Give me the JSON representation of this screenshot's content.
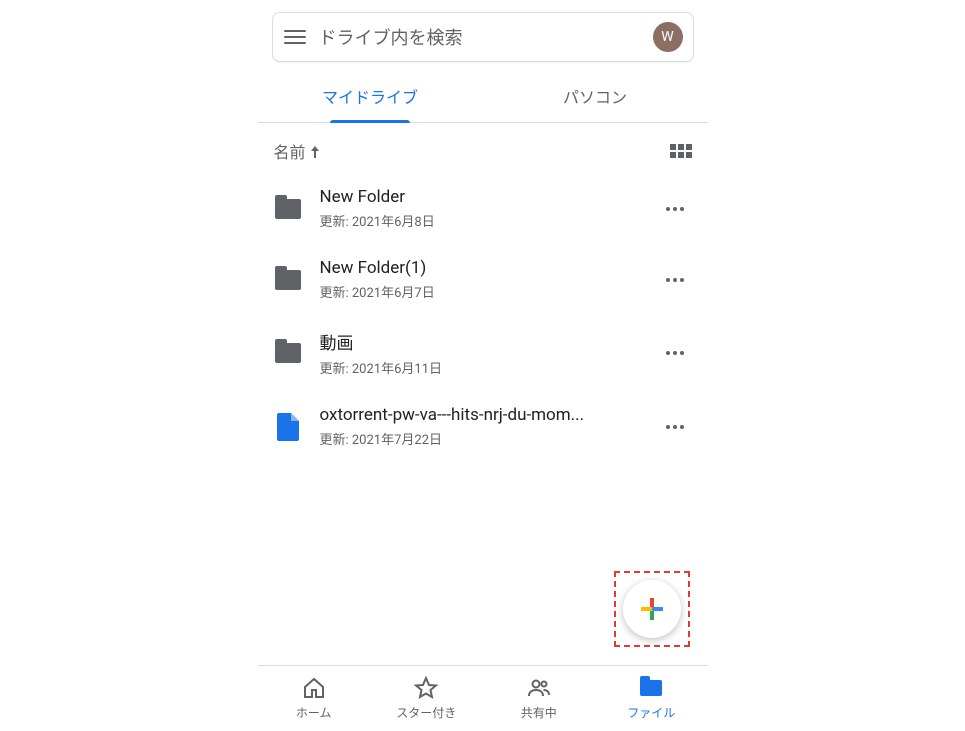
{
  "search": {
    "placeholder": "ドライブ内を検索"
  },
  "avatar": {
    "initial": "W"
  },
  "tabs": [
    {
      "label": "マイドライブ",
      "active": true
    },
    {
      "label": "パソコン",
      "active": false
    }
  ],
  "sort": {
    "label": "名前"
  },
  "files": [
    {
      "name": "New Folder",
      "meta": "更新: 2021年6月8日",
      "type": "folder"
    },
    {
      "name": "New Folder(1)",
      "meta": "更新: 2021年6月7日",
      "type": "folder"
    },
    {
      "name": "動画",
      "meta": "更新: 2021年6月11日",
      "type": "folder"
    },
    {
      "name": "oxtorrent-pw-va---hits-nrj-du-mom...",
      "meta": "更新: 2021年7月22日",
      "type": "doc"
    }
  ],
  "nav": [
    {
      "label": "ホーム",
      "icon": "home",
      "active": false
    },
    {
      "label": "スター付き",
      "icon": "star",
      "active": false
    },
    {
      "label": "共有中",
      "icon": "shared",
      "active": false
    },
    {
      "label": "ファイル",
      "icon": "files",
      "active": true
    }
  ]
}
